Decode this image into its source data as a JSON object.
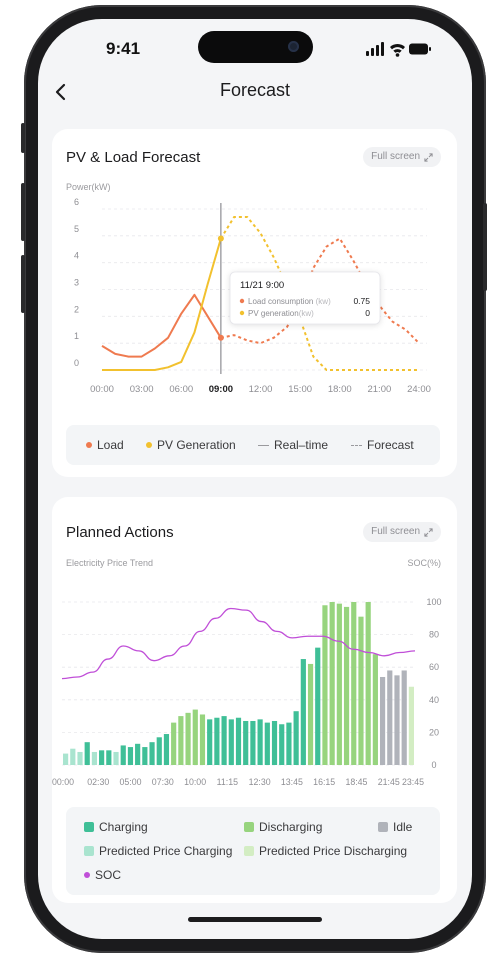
{
  "status_bar": {
    "time": "9:41"
  },
  "nav": {
    "title": "Forecast"
  },
  "forecast_card": {
    "title": "PV & Load Forecast",
    "fullscreen_label": "Full screen",
    "tooltip": {
      "time": "11/21 9:00",
      "rows": [
        {
          "label": "Load consumption",
          "unit": "(kw)",
          "value": "0.75"
        },
        {
          "label": "PV generation",
          "unit": "(kw)",
          "value": "0"
        }
      ]
    },
    "legend": {
      "load": "Load",
      "pv": "PV Generation",
      "realtime": "Real–time",
      "forecast": "Forecast"
    }
  },
  "actions_card": {
    "title": "Planned Actions",
    "fullscreen_label": "Full screen",
    "legend": {
      "charging": "Charging",
      "discharging": "Discharging",
      "idle": "Idle",
      "pred_charging": "Predicted Price Charging",
      "pred_discharging": "Predicted Price Discharging",
      "soc": "SOC"
    }
  },
  "colors": {
    "load": "#ef7a4f",
    "pv": "#f2c12e",
    "charging": "#3fbf97",
    "discharging": "#97d47e",
    "idle": "#b0b3ba",
    "pred_charging": "#a9e4cf",
    "pred_discharging": "#d3edc3",
    "soc": "#c04fd8"
  },
  "chart_data": [
    {
      "type": "line",
      "title": "PV & Load Forecast",
      "ylabel": "Power(kW)",
      "ylim": [
        0,
        6
      ],
      "yticks": [
        "0",
        "1",
        "2",
        "3",
        "4",
        "5",
        "6"
      ],
      "x_ticks": [
        "00:00",
        "03:00",
        "06:00",
        "09:00",
        "12:00",
        "15:00",
        "18:00",
        "21:00",
        "24:00"
      ],
      "highlight_tick": "09:00",
      "realtime_x": 9,
      "grid": true,
      "series": [
        {
          "name": "Load",
          "color": "#ef7a4f",
          "x": [
            0,
            1,
            2,
            3,
            4,
            5,
            6,
            7,
            8,
            9,
            10,
            11,
            12,
            13,
            14,
            15,
            16,
            17,
            18,
            19,
            20,
            21,
            22,
            23,
            24
          ],
          "y": [
            0.9,
            0.6,
            0.5,
            0.5,
            0.8,
            1.2,
            2.1,
            2.8,
            2.0,
            1.2,
            1.3,
            1.1,
            1.0,
            1.2,
            1.6,
            2.4,
            3.8,
            4.6,
            4.9,
            4.1,
            3.2,
            2.4,
            1.8,
            1.5,
            1.0
          ]
        },
        {
          "name": "PV Generation",
          "color": "#f2c12e",
          "x": [
            0,
            1,
            2,
            3,
            4,
            5,
            6,
            7,
            8,
            9,
            10,
            11,
            12,
            13,
            14,
            15,
            16,
            17,
            18,
            19,
            20,
            21,
            22,
            23,
            24
          ],
          "y": [
            0,
            0,
            0,
            0,
            0,
            0.1,
            0.3,
            1.4,
            3.2,
            4.9,
            5.7,
            5.7,
            5.1,
            4.2,
            3.1,
            1.9,
            0.5,
            0,
            0,
            0,
            0,
            0,
            0,
            0,
            0
          ]
        }
      ]
    },
    {
      "type": "bar",
      "title": "Planned Actions",
      "ylabel_left": "Electricity Price Trend",
      "ylabel_right": "SOC(%)",
      "y_right_ticks": [
        "0",
        "20",
        "40",
        "60",
        "80",
        "100"
      ],
      "ylim_right": [
        0,
        100
      ],
      "ylim_price": [
        0,
        100
      ],
      "x_ticks": [
        "00:00",
        "02:30",
        "05:00",
        "07:30",
        "10:00",
        "11:15",
        "12:30",
        "13:45",
        "16:15",
        "18:45",
        "21:45",
        "23:45"
      ],
      "bars": {
        "values": [
          7,
          10,
          8,
          14,
          8,
          9,
          9,
          8,
          12,
          11,
          13,
          11,
          14,
          17,
          19,
          26,
          30,
          32,
          34,
          31,
          28,
          29,
          30,
          28,
          29,
          27,
          27,
          28,
          26,
          27,
          25,
          26,
          33,
          65,
          62,
          72,
          98,
          100,
          99,
          97,
          100,
          91,
          100,
          68,
          54,
          58,
          55,
          58,
          48
        ],
        "actions": [
          "pred_charging",
          "pred_charging",
          "pred_charging",
          "charging",
          "pred_charging",
          "charging",
          "charging",
          "pred_charging",
          "charging",
          "charging",
          "charging",
          "charging",
          "charging",
          "charging",
          "charging",
          "discharging",
          "discharging",
          "discharging",
          "discharging",
          "discharging",
          "charging",
          "charging",
          "charging",
          "charging",
          "charging",
          "charging",
          "charging",
          "charging",
          "charging",
          "charging",
          "charging",
          "charging",
          "charging",
          "charging",
          "discharging",
          "charging",
          "discharging",
          "discharging",
          "discharging",
          "discharging",
          "discharging",
          "discharging",
          "discharging",
          "discharging",
          "idle",
          "idle",
          "idle",
          "idle",
          "pred_discharging"
        ]
      },
      "soc_series": {
        "name": "SOC",
        "color": "#c04fd8",
        "values": [
          53,
          54,
          57,
          65,
          73,
          70,
          64,
          67,
          73,
          82,
          90,
          96,
          95,
          88,
          82,
          78,
          79,
          79,
          76,
          71,
          69,
          67,
          69,
          70
        ]
      }
    }
  ]
}
